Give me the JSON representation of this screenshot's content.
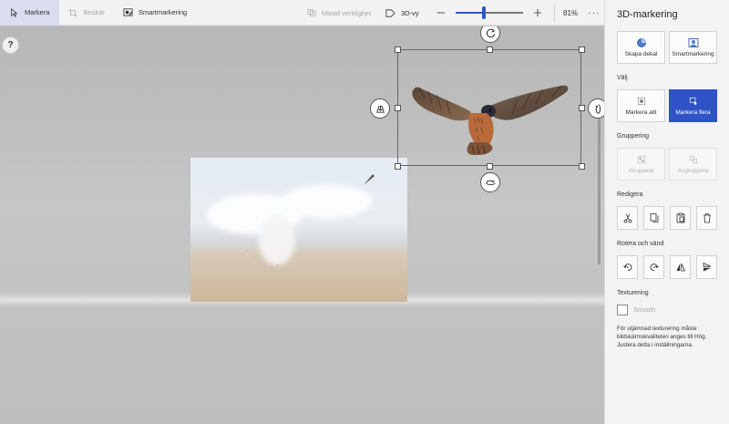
{
  "toolbar": {
    "select_label": "Markera",
    "crop_label": "Beskär",
    "magic_select_label": "Smartmarkering",
    "mixed_reality_label": "Mixad verklighet",
    "view3d_label": "3D-vy",
    "zoom_value": "81%",
    "zoom_fraction": 0.42,
    "more_label": "···"
  },
  "canvas": {
    "help_label": "?"
  },
  "panel": {
    "title": "3D-markering",
    "top_buttons": {
      "sticker": "Skapa dekal",
      "magic": "Smartmarkering"
    },
    "select_section": "Välj",
    "select_all": "Markera allt",
    "select_multiple": "Markera flera",
    "grouping_section": "Gruppering",
    "group": "Gruppera",
    "ungroup": "Avgruppera",
    "edit_section": "Redigera",
    "rotate_section": "Rotera och vänd",
    "texture_section": "Texturering",
    "smooth_label": "Smooth",
    "info_text": "För utjämnad texturering måste bildskärmskvaliteten anges till Hög. Justera detta i inställningarna."
  },
  "colors": {
    "accent": "#2f53c6",
    "toolbar_active": "#dcdcf0"
  }
}
